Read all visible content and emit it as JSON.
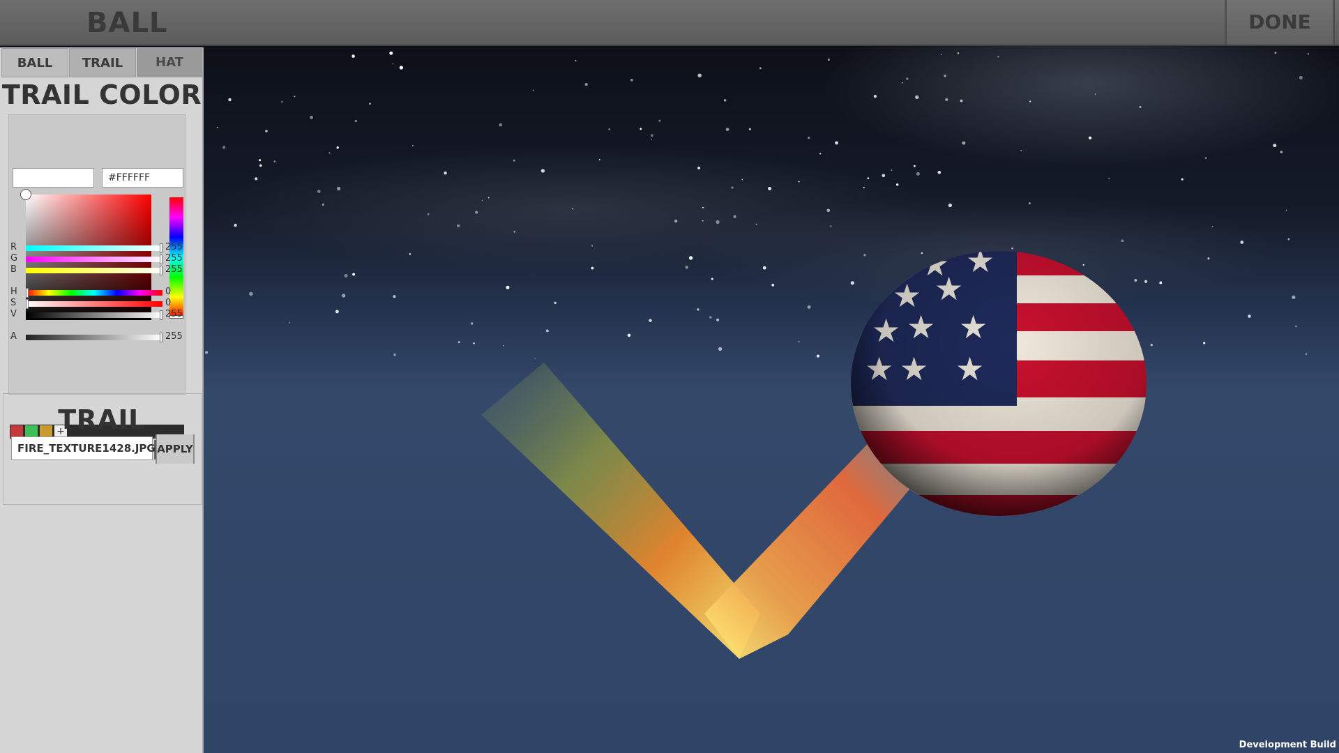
{
  "topbar": {
    "title": "BALL",
    "done_label": "DONE"
  },
  "tabs": [
    {
      "label": "BALL"
    },
    {
      "label": "TRAIL"
    },
    {
      "label": "HAT"
    }
  ],
  "trail_color": {
    "title": "TRAIL COLOR",
    "preview_value": "",
    "hex_value": "#FFFFFF",
    "sliders": [
      {
        "label": "R",
        "value": "255",
        "level": 1.0
      },
      {
        "label": "G",
        "value": "255",
        "level": 1.0
      },
      {
        "label": "B",
        "value": "255",
        "level": 1.0
      },
      {
        "label": "H",
        "value": "0",
        "level": 0.0
      },
      {
        "label": "S",
        "value": "0",
        "level": 0.0
      },
      {
        "label": "V",
        "value": "255",
        "level": 1.0
      },
      {
        "label": "A",
        "value": "255",
        "level": 1.0
      }
    ],
    "swatches": [
      "#c43a3a",
      "#3fbf55",
      "#c99a2e"
    ],
    "add_swatch_symbol": "+"
  },
  "trail_texture": {
    "title": "TRAIL TEXTURE",
    "file_name": "FIRE_TEXTURE1428.JPG",
    "apply_label": "APPLY"
  },
  "footer": {
    "dev_build": "Development Build"
  },
  "colors": {
    "sky_top": "#0b0d14",
    "sky_bottom": "#2f4467",
    "panel_bg": "#d6d6d6",
    "topbar_bg": "#666666"
  }
}
